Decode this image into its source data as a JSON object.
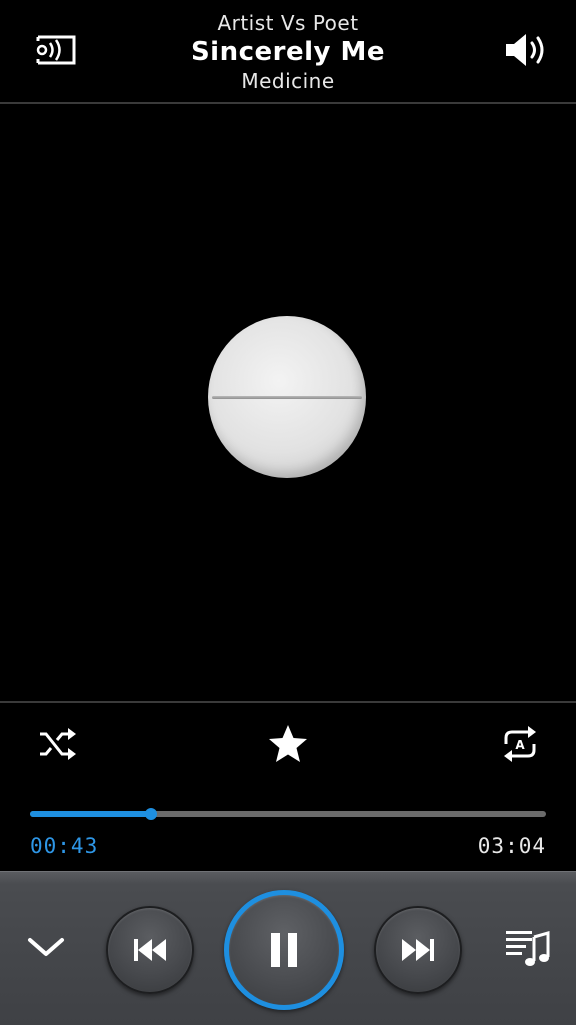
{
  "header": {
    "artist": "Artist Vs Poet",
    "song_title": "Sincerely Me",
    "album": "Medicine",
    "screen_mirror_icon": "screen-mirror-icon",
    "volume_icon": "volume-icon"
  },
  "artwork": {
    "description_icon": "album-art-pill"
  },
  "controls": {
    "shuffle_icon": "shuffle-icon",
    "favorite_icon": "star-icon",
    "repeat_icon": "repeat-all-icon",
    "repeat_badge": "A"
  },
  "progress": {
    "elapsed": "00:43",
    "total": "03:04",
    "fraction": 0.234
  },
  "bottom": {
    "collapse_icon": "chevron-down-icon",
    "prev_icon": "previous-track-icon",
    "play_pause_icon": "pause-icon",
    "next_icon": "next-track-icon",
    "playlist_icon": "playlist-icon"
  },
  "colors": {
    "accent": "#1e8fe0",
    "background": "#000000",
    "bar": "#45474b"
  }
}
